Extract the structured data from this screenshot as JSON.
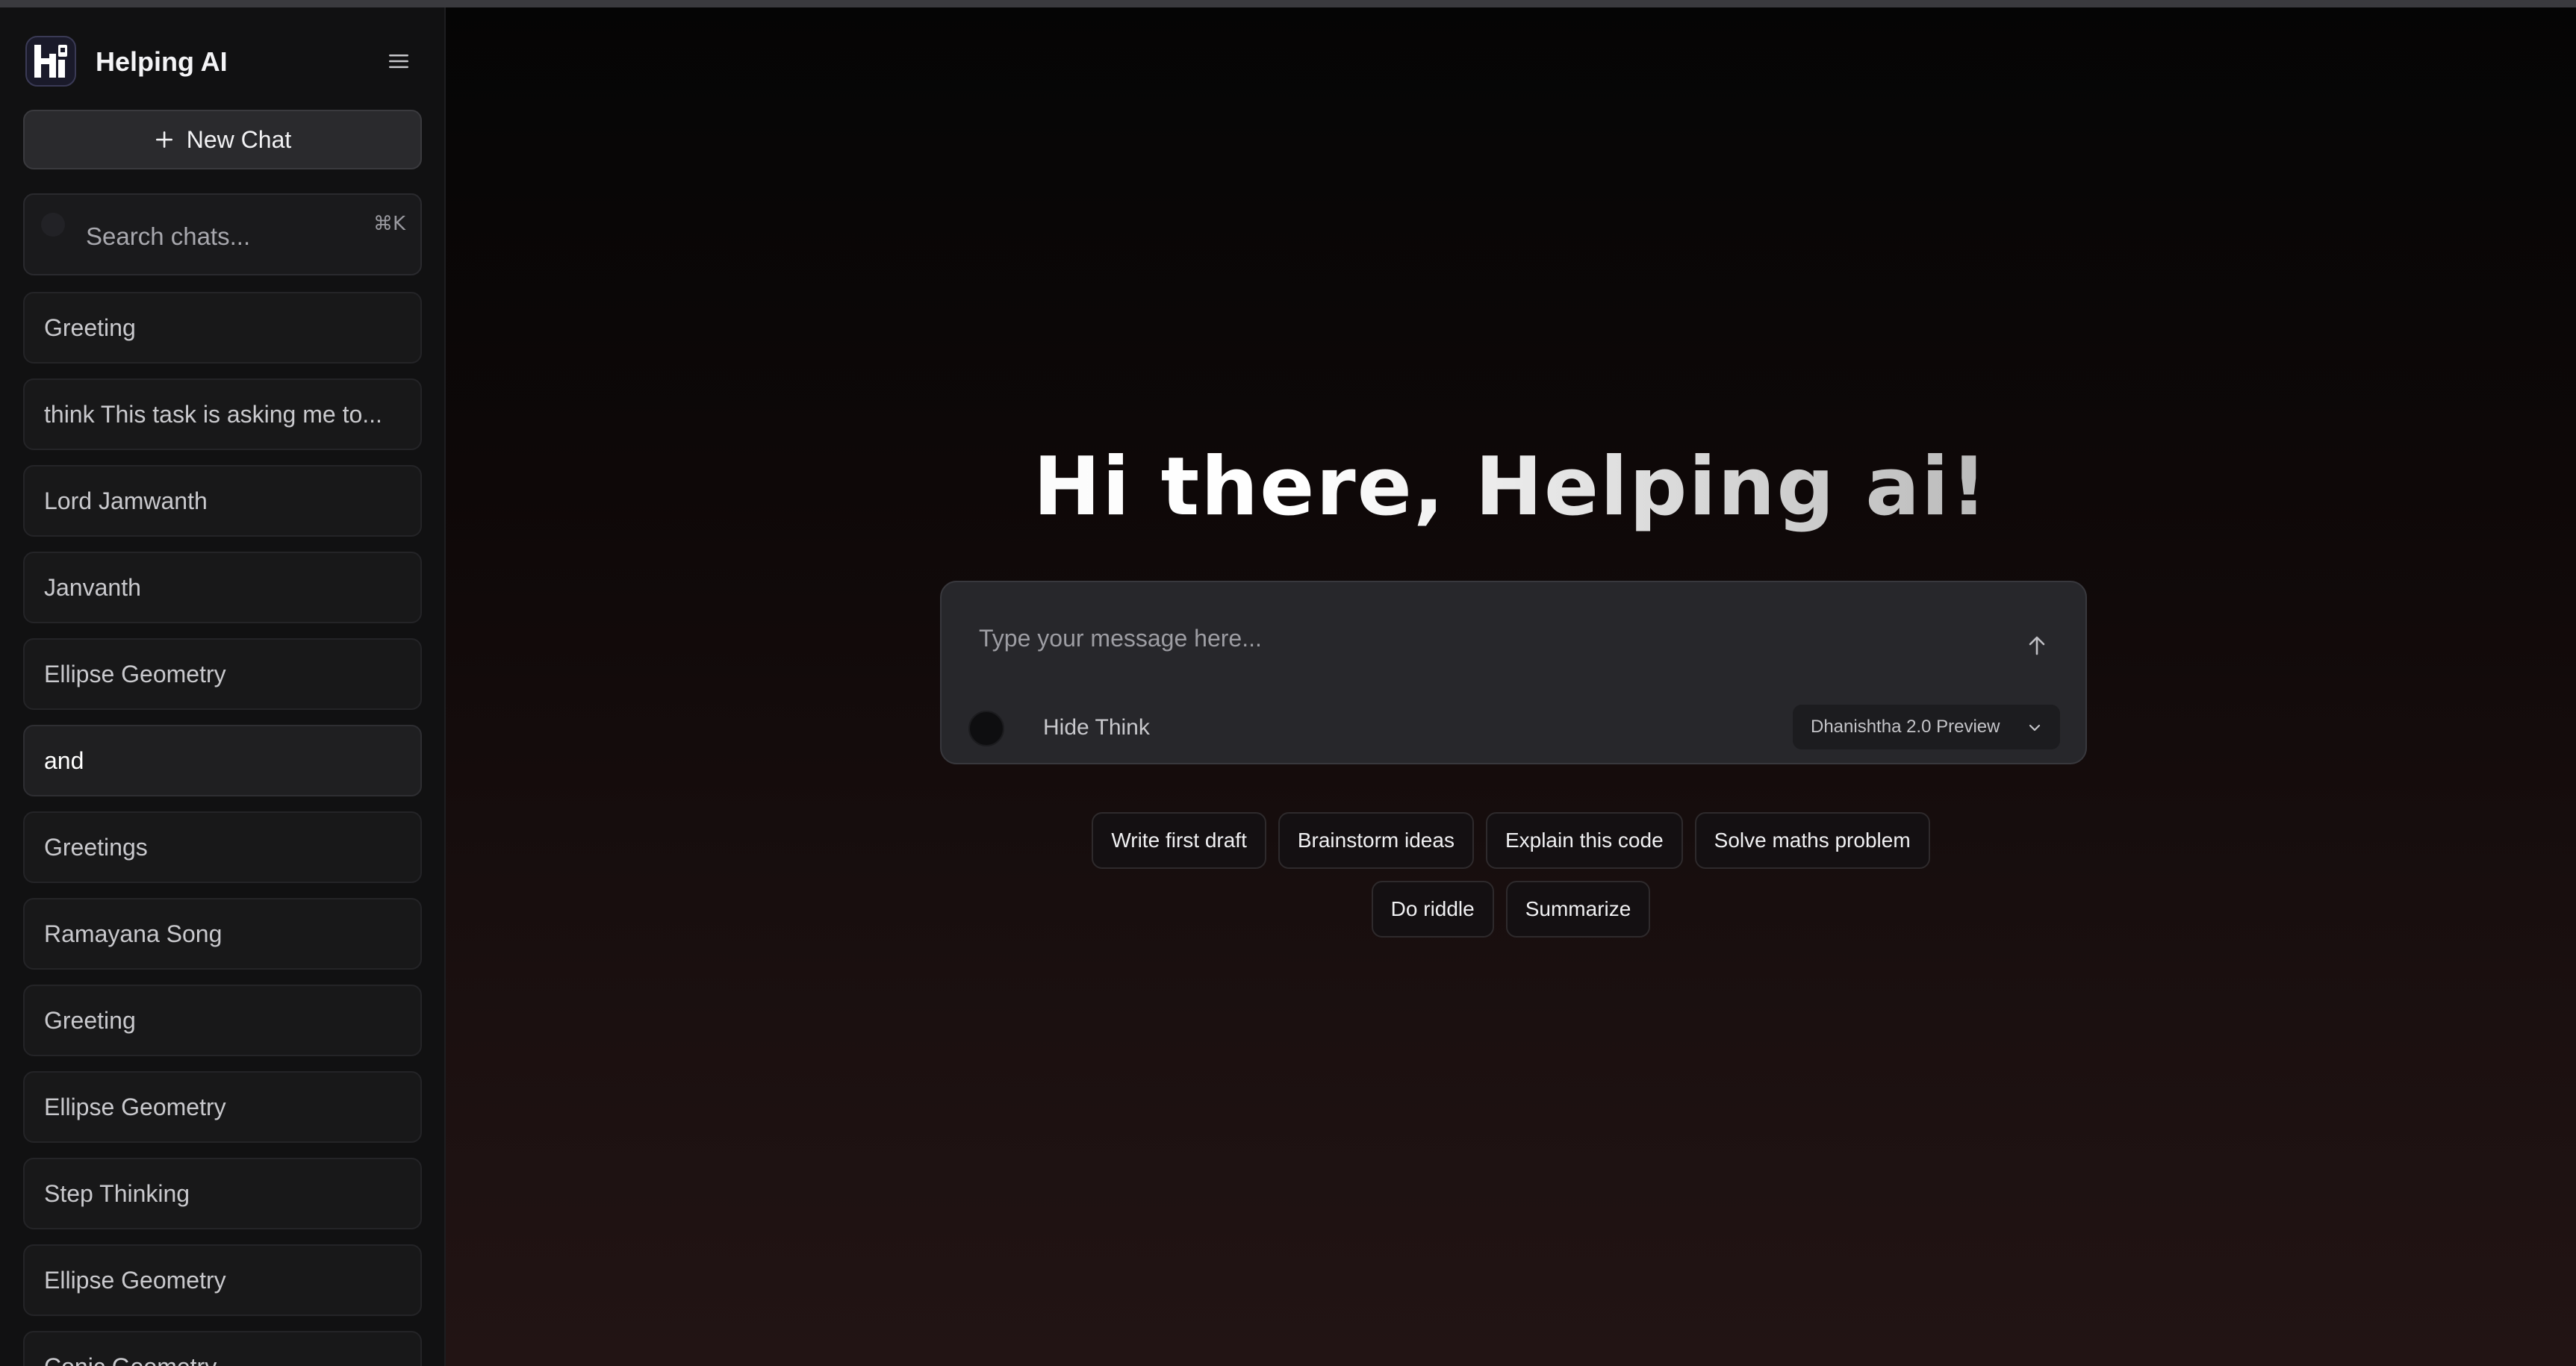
{
  "app": {
    "name": "Helping AI"
  },
  "sidebar": {
    "new_chat_label": "New Chat",
    "search": {
      "placeholder": "Search chats...",
      "shortcut": "⌘K"
    },
    "chats": [
      {
        "title": "Greeting",
        "active": false
      },
      {
        "title": "think This task is asking me to...",
        "active": false
      },
      {
        "title": "Lord Jamwanth",
        "active": false
      },
      {
        "title": "Janvanth",
        "active": false
      },
      {
        "title": "Ellipse Geometry",
        "active": false
      },
      {
        "title": "and",
        "active": true
      },
      {
        "title": "Greetings",
        "active": false
      },
      {
        "title": "Ramayana Song",
        "active": false
      },
      {
        "title": "Greeting",
        "active": false
      },
      {
        "title": "Ellipse Geometry",
        "active": false
      },
      {
        "title": "Step Thinking",
        "active": false
      },
      {
        "title": "Ellipse Geometry",
        "active": false
      },
      {
        "title": "Conic Geometry",
        "active": false
      }
    ]
  },
  "main": {
    "greeting": "Hi there, Helping ai!",
    "composer": {
      "placeholder": "Type your message here...",
      "think_label": "Hide Think",
      "model": "Dhanishtha 2.0 Preview"
    },
    "suggestions": {
      "row1": [
        "Write first draft",
        "Brainstorm ideas",
        "Explain this code",
        "Solve maths problem"
      ],
      "row2": [
        "Do riddle",
        "Summarize"
      ]
    }
  },
  "icons": {
    "menu": "hamburger-menu-icon",
    "plus": "plus-icon",
    "send": "arrow-up-icon",
    "chevron": "chevron-down-icon"
  }
}
